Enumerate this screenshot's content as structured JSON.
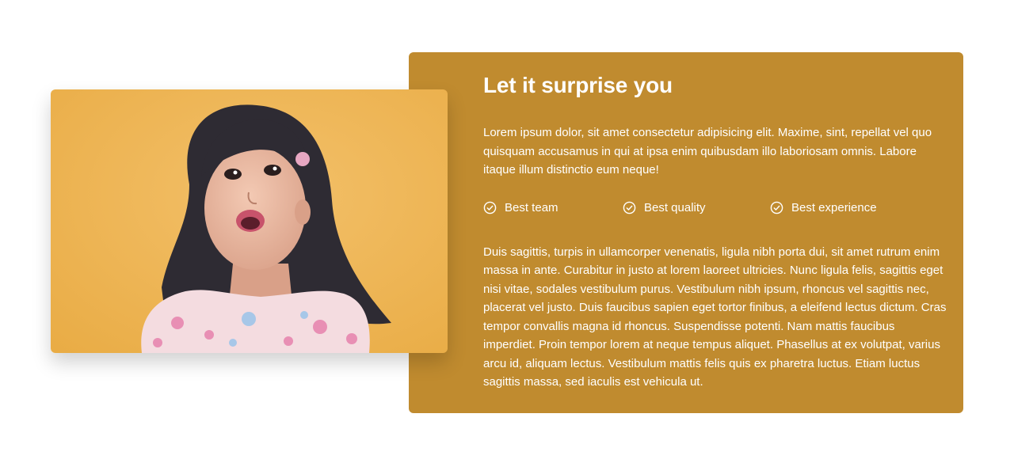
{
  "colors": {
    "panel_background": "#C08B2F",
    "photo_background": "#EFB553",
    "text": "#FFFFFF"
  },
  "photo": {
    "description_icon": "girl-photo"
  },
  "section": {
    "title": "Let it surprise you",
    "intro": "Lorem ipsum dolor, sit amet consectetur adipisicing elit. Maxime, sint, repellat vel quo quisquam accusamus in qui at ipsa enim quibusdam illo laboriosam omnis. Labore itaque illum distinctio eum neque!",
    "features": [
      {
        "icon": "check-circle-icon",
        "label": "Best team"
      },
      {
        "icon": "check-circle-icon",
        "label": "Best quality"
      },
      {
        "icon": "check-circle-icon",
        "label": "Best experience"
      }
    ],
    "body": "Duis sagittis, turpis in ullamcorper venenatis, ligula nibh porta dui, sit amet rutrum enim massa in ante. Curabitur in justo at lorem laoreet ultricies. Nunc ligula felis, sagittis eget nisi vitae, sodales vestibulum purus. Vestibulum nibh ipsum, rhoncus vel sagittis nec, placerat vel justo. Duis faucibus sapien eget tortor finibus, a eleifend lectus dictum. Cras tempor convallis magna id rhoncus. Suspendisse potenti. Nam mattis faucibus imperdiet. Proin tempor lorem at neque tempus aliquet. Phasellus at ex volutpat, varius arcu id, aliquam lectus. Vestibulum mattis felis quis ex pharetra luctus. Etiam luctus sagittis massa, sed iaculis est vehicula ut."
  }
}
